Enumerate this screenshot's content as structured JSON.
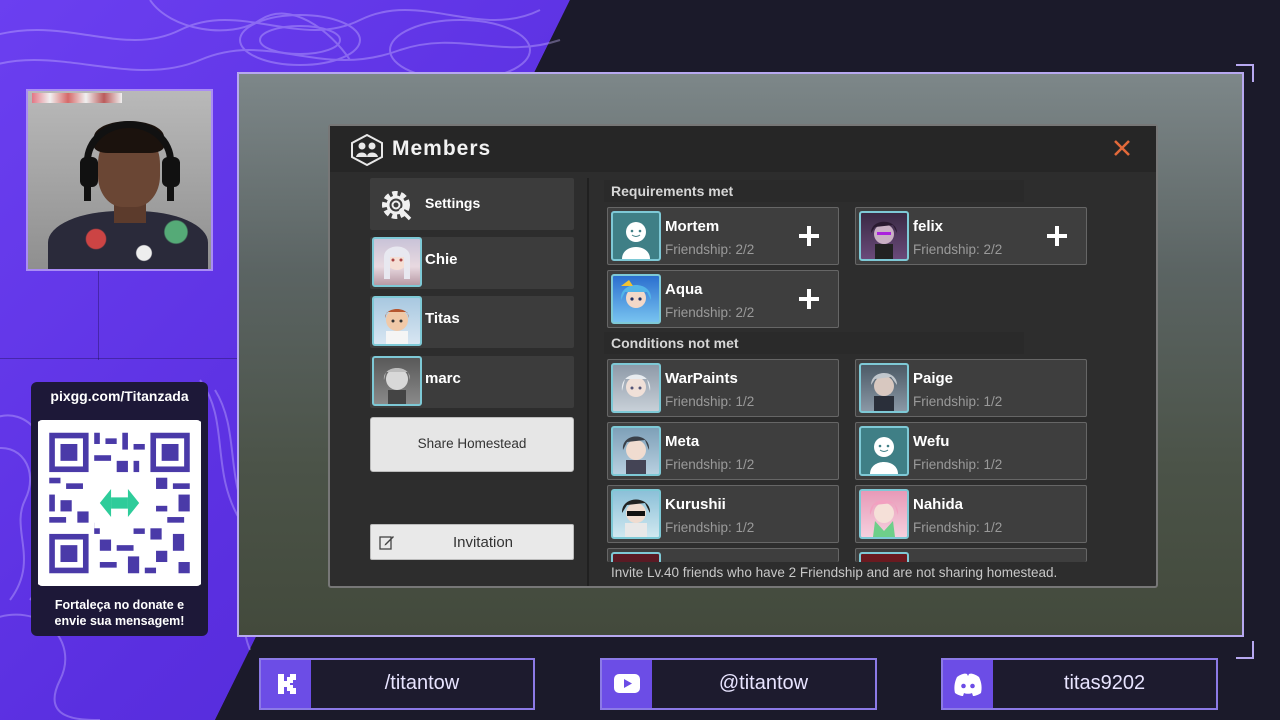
{
  "overlay": {
    "qr_url": "pixgg.com/Titanzada",
    "qr_caption_line1": "Fortaleça no donate e",
    "qr_caption_line2": "envie sua mensagem!",
    "accent_color": "#6c4de6"
  },
  "dialog": {
    "title": "Members",
    "sidebar": {
      "settings_label": "Settings",
      "members": [
        {
          "name": "Chie"
        },
        {
          "name": "Titas"
        },
        {
          "name": "marc"
        }
      ],
      "share_label": "Share Homestead",
      "invite_label": "Invitation"
    },
    "requirements_met_label": "Requirements met",
    "conditions_not_met_label": "Conditions not met",
    "requirements_met": [
      {
        "name": "Mortem",
        "friendship": "Friendship: 2/2"
      },
      {
        "name": "felix",
        "friendship": "Friendship: 2/2"
      },
      {
        "name": "Aqua",
        "friendship": "Friendship: 2/2"
      }
    ],
    "conditions_not_met": [
      {
        "name": "WarPaints",
        "friendship": "Friendship: 1/2"
      },
      {
        "name": "Paige",
        "friendship": "Friendship: 1/2"
      },
      {
        "name": "Meta",
        "friendship": "Friendship: 1/2"
      },
      {
        "name": "Wefu",
        "friendship": "Friendship: 1/2"
      },
      {
        "name": "Kurushii",
        "friendship": "Friendship: 1/2"
      },
      {
        "name": "Nahida",
        "friendship": "Friendship: 1/2"
      }
    ],
    "footer_note": "Invite Lv.40 friends who have 2 Friendship and are not sharing homestead."
  },
  "socials": {
    "kick": "/titantow",
    "youtube": "@titantow",
    "discord": "titas9202"
  }
}
